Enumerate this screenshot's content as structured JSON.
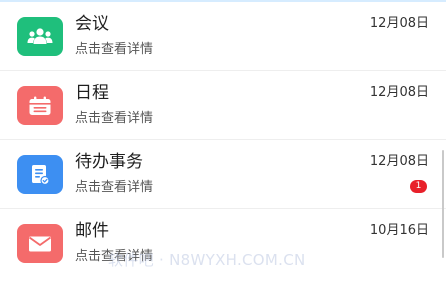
{
  "items": [
    {
      "title": "会议",
      "subtitle": "点击查看详情",
      "date": "12月08日",
      "icon": "people-group-icon",
      "icon_color": "#1fbf7c"
    },
    {
      "title": "日程",
      "subtitle": "点击查看详情",
      "date": "12月08日",
      "icon": "calendar-icon",
      "icon_color": "#f46b6b"
    },
    {
      "title": "待办事务",
      "subtitle": "点击查看详情",
      "date": "12月08日",
      "badge": "1",
      "icon": "todo-document-icon",
      "icon_color": "#3d8ff2"
    },
    {
      "title": "邮件",
      "subtitle": "点击查看详情",
      "date": "10月16日",
      "icon": "mail-icon",
      "icon_color": "#f46b6b"
    }
  ],
  "watermark": "软件吧 · N8WYXH.COM.CN",
  "colors": {
    "badge": "#e8202a",
    "divider": "#eeeeee"
  }
}
